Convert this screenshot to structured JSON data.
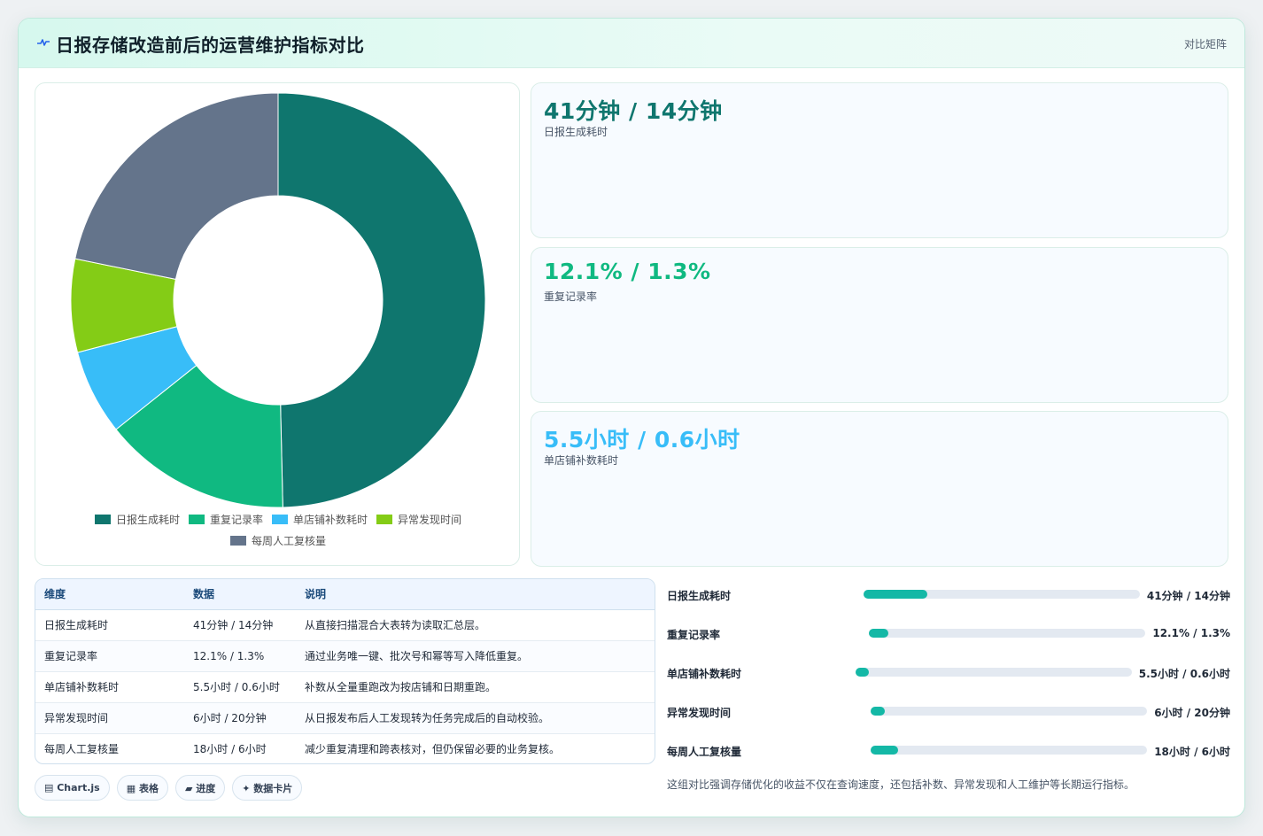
{
  "header": {
    "title": "日报存储改造前后的运营维护指标对比",
    "mode_label": "对比矩阵"
  },
  "chart_data": {
    "type": "pie",
    "categories": [
      "日报生成耗时",
      "重复记录率",
      "单店铺补数耗时",
      "异常发现时间",
      "每周人工复核量"
    ],
    "values": [
      41,
      12.1,
      5.5,
      6,
      18
    ],
    "colors": [
      "#0f766e",
      "#10b981",
      "#38bdf8",
      "#84cc16",
      "#64748b"
    ],
    "legend_position": "bottom"
  },
  "kpis": [
    {
      "value": "41分钟 / 14分钟",
      "label": "日报生成耗时",
      "color": "#0f766e"
    },
    {
      "value": "12.1% / 1.3%",
      "label": "重复记录率",
      "color": "#10b981"
    },
    {
      "value": "5.5小时 / 0.6小时",
      "label": "单店铺补数耗时",
      "color": "#38bdf8"
    }
  ],
  "table": {
    "headers": [
      "维度",
      "数据",
      "说明"
    ],
    "rows": [
      [
        "日报生成耗时",
        "41分钟 / 14分钟",
        "从直接扫描混合大表转为读取汇总层。"
      ],
      [
        "重复记录率",
        "12.1% / 1.3%",
        "通过业务唯一键、批次号和幂等写入降低重复。"
      ],
      [
        "单店铺补数耗时",
        "5.5小时 / 0.6小时",
        "补数从全量重跑改为按店铺和日期重跑。"
      ],
      [
        "异常发现时间",
        "6小时 / 20分钟",
        "从日报发布后人工发现转为任务完成后的自动校验。"
      ],
      [
        "每周人工复核量",
        "18小时 / 6小时",
        "减少重复清理和跨表核对，但仍保留必要的业务复核。"
      ]
    ]
  },
  "pills": [
    "▤ Chart.js",
    "▦ 表格",
    "▰ 进度",
    "✦ 数据卡片"
  ],
  "progress": [
    {
      "label": "日报生成耗时",
      "value": "41分钟 / 14分钟",
      "fraction": 0.23
    },
    {
      "label": "重复记录率",
      "value": "12.1% / 1.3%",
      "fraction": 0.07
    },
    {
      "label": "单店铺补数耗时",
      "value": "5.5小时 / 0.6小时",
      "fraction": 0.05
    },
    {
      "label": "异常发现时间",
      "value": "6小时 / 20分钟",
      "fraction": 0.05
    },
    {
      "label": "每周人工复核量",
      "value": "18小时 / 6小时",
      "fraction": 0.1
    }
  ],
  "note": "这组对比强调存储优化的收益不仅在查询速度，还包括补数、异常发现和人工维护等长期运行指标。"
}
